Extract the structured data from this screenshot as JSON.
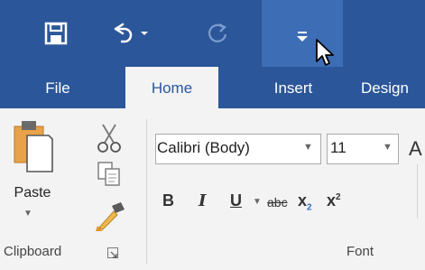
{
  "quick_access": {
    "items": [
      {
        "icon": "save-icon"
      },
      {
        "icon": "undo-icon"
      },
      {
        "icon": "redo-icon"
      },
      {
        "icon": "customize-qat-icon"
      }
    ],
    "cursor_icon": "mouse-pointer-icon"
  },
  "tabs": [
    {
      "label": "File"
    },
    {
      "label": "Home",
      "active": true
    },
    {
      "label": "Insert"
    },
    {
      "label": "Design"
    }
  ],
  "clipboard": {
    "paste_label": "Paste",
    "group_label": "Clipboard"
  },
  "font": {
    "font_name": "Calibri (Body)",
    "font_size": "11",
    "grow_label": "A",
    "bold": "B",
    "italic": "I",
    "underline": "U",
    "strike": "abc",
    "subscript_base": "x",
    "subscript_mark": "2",
    "superscript_base": "x",
    "superscript_mark": "2",
    "group_label": "Font"
  },
  "colors": {
    "ribbon_blue": "#2b579a",
    "hover_blue": "#3d6db4",
    "ribbon_bg": "#f3f3f3"
  }
}
